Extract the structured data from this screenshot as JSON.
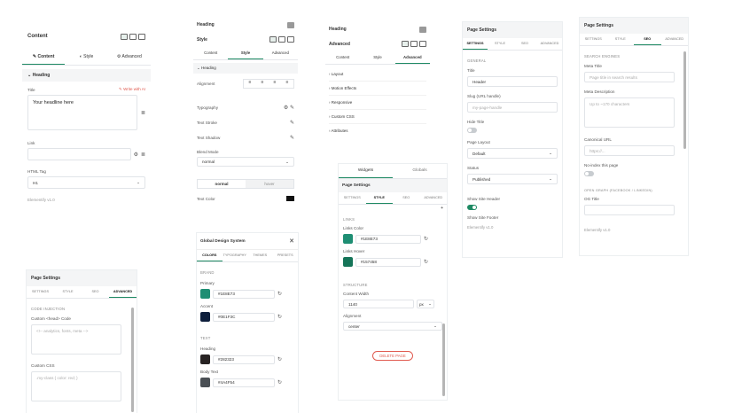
{
  "p1": {
    "title": "Content",
    "tabs": [
      "Content",
      "Style",
      "Advanced"
    ],
    "section": "Heading",
    "title_label": "Title",
    "write_ai": "Write with AI",
    "textarea_value": "Your headline here",
    "link_label": "Link",
    "tag_label": "HTML Tag",
    "tag_value": "H1",
    "footer": "Elementify v1.0"
  },
  "p2": {
    "title": "Heading",
    "style_label": "Style",
    "tabs": [
      "Content",
      "Style",
      "Advanced"
    ],
    "section": "Heading",
    "alignment": "Alignment",
    "typography": "Typography",
    "stroke": "Text Stroke",
    "shadow": "Text Shadow",
    "blend": "Blend Mode",
    "blend_value": "normal",
    "normal": "normal",
    "hover": "hover",
    "color": "Text Color"
  },
  "p3": {
    "title": "Heading",
    "advanced": "Advanced",
    "tabs": [
      "Content",
      "Style",
      "Advanced"
    ],
    "items": [
      "Layout",
      "Motion Effects",
      "Responsive",
      "Custom CSS",
      "Attributes"
    ]
  },
  "p4": {
    "tabs": [
      "Widgets",
      "Globals"
    ],
    "title": "Page Settings",
    "subtabs": [
      "SETTINGS",
      "STYLE",
      "SEO",
      "ADVANCED"
    ],
    "links": "LINKS",
    "link_color": "Links Color",
    "link_color_val": "#1E8E73",
    "link_hover": "Links Hover",
    "link_hover_val": "#157458",
    "structure": "STRUCTURE",
    "content_width": "Content Width",
    "width_val": "1140",
    "unit": "px",
    "alignment": "Alignment",
    "align_val": "center",
    "delete": "DELETE PAGE"
  },
  "p5": {
    "title": "Page Settings",
    "subtabs": [
      "SETTINGS",
      "STYLE",
      "SEO",
      "ADVANCED"
    ],
    "general": "GENERAL",
    "title_label": "Title",
    "title_val": "Header",
    "slug_label": "Slug (URL handle)",
    "slug_ph": "my-page-handle",
    "hide": "Hide Title",
    "layout": "Page Layout",
    "layout_val": "Default",
    "status": "Status",
    "status_val": "Published",
    "header": "Show Site Header",
    "footer_tg": "Show Site Footer",
    "footer": "Elementify v1.0"
  },
  "p6": {
    "title": "Page Settings",
    "subtabs": [
      "SETTINGS",
      "STYLE",
      "SEO",
      "ADVANCED"
    ],
    "search": "SEARCH ENGINES",
    "meta_title": "Meta Title",
    "meta_ph": "Page title in search results",
    "meta_desc": "Meta Description",
    "desc_ph": "Up to ~170 characters",
    "canonical": "Canonical URL",
    "canon_ph": "https://...",
    "noindex": "No-index this page",
    "og": "OPEN GRAPH (FACEBOOK / LINKEDIN)",
    "og_title": "OG Title",
    "footer": "Elementify v1.0"
  },
  "p7": {
    "title": "Page Settings",
    "subtabs": [
      "SETTINGS",
      "STYLE",
      "SEO",
      "ADVANCED"
    ],
    "code": "CODE INJECTION",
    "head_label": "Custom <head> Code",
    "head_ph": "<!-- analytics, fonts, meta -->",
    "css_label": "Custom CSS",
    "css_ph": ".my-class { color: red; }"
  },
  "p8": {
    "title": "Global Design System",
    "tabs": [
      "COLORS",
      "TYPOGRAPHY",
      "THEMES",
      "PRESETS"
    ],
    "brand": "BRAND",
    "primary": "Primary",
    "primary_val": "#1E8E73",
    "accent": "Accent",
    "accent_val": "#0E1F3C",
    "text": "TEXT",
    "heading": "Heading",
    "heading_val": "#282323",
    "body": "Body Text",
    "body_val": "#4A4F54"
  },
  "colors": {
    "primary": "#1e8e73",
    "hover": "#157458",
    "accent": "#0e1f3c",
    "heading": "#282323",
    "body": "#4a4f54",
    "danger": "#e05a4f"
  }
}
